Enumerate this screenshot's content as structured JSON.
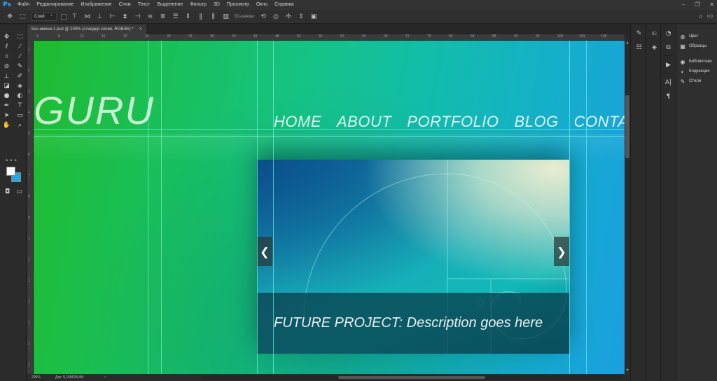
{
  "app": {
    "logo": "Ps",
    "menu": [
      "Файл",
      "Редактирование",
      "Изображение",
      "Слои",
      "Текст",
      "Выделение",
      "Фильтр",
      "3D",
      "Просмотр",
      "Окно",
      "Справка"
    ],
    "window_controls": [
      "–",
      "❐",
      "✕"
    ]
  },
  "options": {
    "layer_select": "Слой",
    "mode_3d_label": "3D-режим:"
  },
  "document": {
    "tab_title": "Без имени-1.psd @ 200% (слайдер копия, RGB/8#) *",
    "tab_close": "✕"
  },
  "rulers": {
    "horizontal": [
      "4",
      "8",
      "12",
      "16",
      "20",
      "24",
      "28",
      "32",
      "36",
      "40",
      "44",
      "48",
      "52",
      "56",
      "60",
      "64",
      "68",
      "72",
      "76",
      "80",
      "84",
      "88",
      "92",
      "96",
      "100",
      "104",
      "108"
    ],
    "vertical": [
      "1",
      "2",
      "3",
      "4",
      "5",
      "6",
      "7",
      "8",
      "9",
      "1",
      "1",
      "1",
      "1",
      "1",
      "1",
      "1"
    ]
  },
  "site": {
    "logo_text": "GURU",
    "nav": [
      "HOME",
      "ABOUT",
      "PORTFOLIO",
      "BLOG",
      "CONTACT"
    ],
    "slider_caption": "FUTURE PROJECT: Description goes here",
    "prev_arrow": "❮",
    "next_arrow": "❯"
  },
  "status": {
    "zoom": "200%",
    "doc_info": "Док: 5,15M/18,4M",
    "arrow": "›"
  },
  "panels": {
    "group1": [
      {
        "icon": "◍",
        "label": "Цвет"
      },
      {
        "icon": "▦",
        "label": "Образцы"
      }
    ],
    "group2": [
      {
        "icon": "◉",
        "label": "Библиотеки"
      },
      {
        "icon": "◐",
        "label": "Коррекция"
      },
      {
        "icon": "✎",
        "label": "Стили"
      }
    ]
  },
  "colors": {
    "accent": "#31a8ff",
    "background_swatch": "#29a6e0",
    "foreground_swatch": "#ffffff",
    "guide": "#8cfff0"
  }
}
